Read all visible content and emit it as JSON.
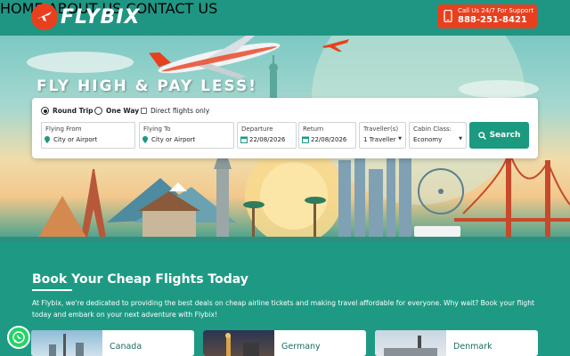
{
  "brand": {
    "name": "FLYBIX"
  },
  "nav": {
    "home": "HOME",
    "about": "ABOUT US",
    "contact": "CONTACT US"
  },
  "call": {
    "small": "Call Us 24/7 For Support",
    "number": "888-251-8421"
  },
  "hero": {
    "title": "FLY HIGH & PAY LESS!"
  },
  "search": {
    "round_trip": "Round Trip",
    "one_way": "One Way",
    "direct": "Direct flights only",
    "from_label": "Flying From",
    "from_placeholder": "City or Airport",
    "to_label": "Flying To",
    "to_placeholder": "City or Airport",
    "departure_label": "Departure",
    "departure_value": "22/08/2026",
    "return_label": "Return",
    "return_value": "22/08/2026",
    "travellers_label": "Traveller(s)",
    "travellers_value": "1 Traveller",
    "cabin_label": "Cabin Class:",
    "cabin_value": "Economy",
    "button": "Search"
  },
  "section": {
    "title": "Book Your Cheap Flights Today",
    "paragraph": "At Flybix, we're dedicated to providing the best deals on cheap airline tickets and making travel affordable for everyone. Why wait? Book your flight today and embark on your next adventure with Flybix!"
  },
  "destinations": [
    {
      "name": "Canada"
    },
    {
      "name": "Germany"
    },
    {
      "name": "Denmark"
    }
  ],
  "colors": {
    "primary": "#1f9683",
    "accent": "#e8401e",
    "button": "#1b9a80"
  },
  "icons": [
    "plane-logo-icon",
    "phone-icon",
    "location-pin-icon",
    "calendar-icon",
    "search-icon",
    "whatsapp-icon"
  ]
}
